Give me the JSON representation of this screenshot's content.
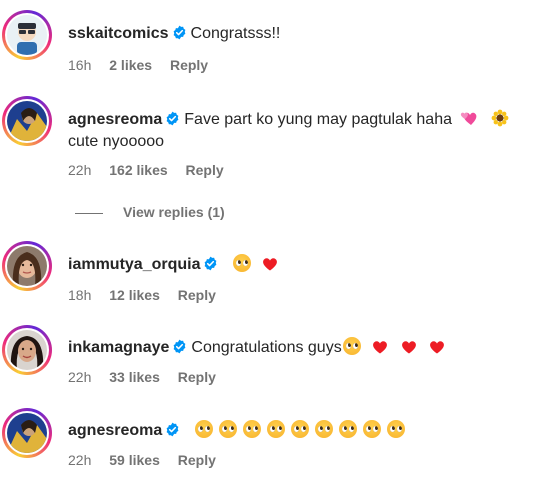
{
  "comments": [
    {
      "username": "sskaitcomics",
      "text": "Congratsss!!",
      "time": "16h",
      "likes": "2 likes",
      "reply": "Reply"
    },
    {
      "username": "agnesreoma",
      "text": "Fave part ko yung may pagtulak haha",
      "text2": "cute nyooooo",
      "time": "22h",
      "likes": "162 likes",
      "reply": "Reply",
      "view_replies": "View replies (1)"
    },
    {
      "username": "iammutya_orquia",
      "text": "",
      "time": "18h",
      "likes": "12 likes",
      "reply": "Reply"
    },
    {
      "username": "inkamagnaye",
      "text": "Congratulations guys",
      "time": "22h",
      "likes": "33 likes",
      "reply": "Reply"
    },
    {
      "username": "agnesreoma",
      "text": "",
      "time": "22h",
      "likes": "59 likes",
      "reply": "Reply"
    }
  ],
  "colors": {
    "verified": "#0095f6",
    "heart": "#ed1c24",
    "meta": "#737373",
    "text": "#262626"
  }
}
